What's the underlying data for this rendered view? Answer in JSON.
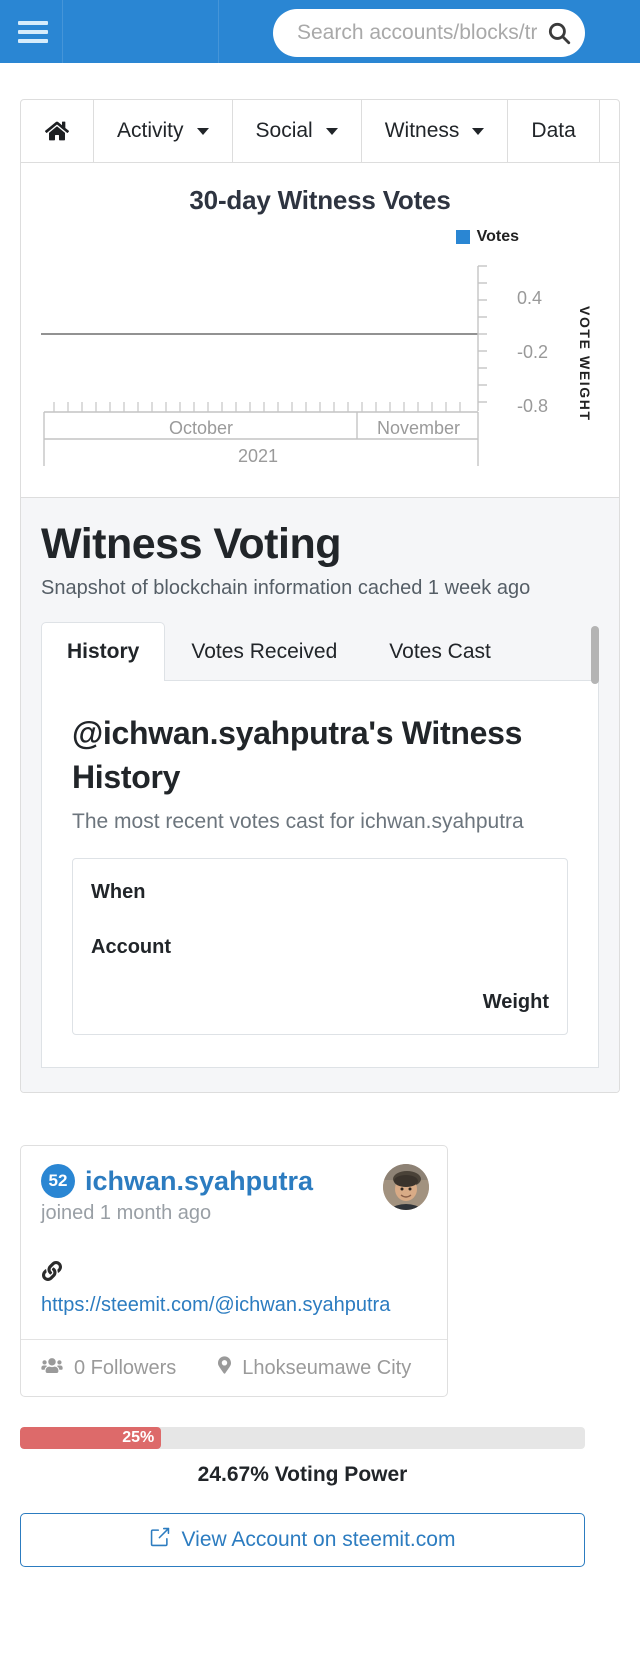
{
  "navbar": {
    "menu_icon": "hamburger-icon",
    "search": {
      "placeholder": "Search accounts/blocks/transactions",
      "value": "",
      "icon": "search-icon"
    }
  },
  "nav_tabs": [
    {
      "label": "",
      "icon": "home-icon",
      "has_caret": false
    },
    {
      "label": "Activity",
      "has_caret": true
    },
    {
      "label": "Social",
      "has_caret": true
    },
    {
      "label": "Witness",
      "has_caret": true
    },
    {
      "label": "Data",
      "has_caret": false
    }
  ],
  "chart_data": {
    "type": "line",
    "title": "30-day Witness Votes",
    "xlabel": "",
    "ylabel": "VOTE WEIGHT",
    "legend": [
      {
        "name": "Votes",
        "color": "#2a86d3"
      }
    ],
    "legend_position": "top-right",
    "grid": false,
    "ylim": [
      -1.1,
      0.7
    ],
    "yticks": [
      0.4,
      -0.2,
      -0.8
    ],
    "ytick_labels": [
      "0.4",
      "-0.2",
      "-0.8"
    ],
    "x_group_year": "2021",
    "x_groups": [
      "October",
      "November"
    ],
    "series": [
      {
        "name": "Votes",
        "x": [],
        "values": []
      }
    ],
    "baseline_value": 0,
    "note": "No vote data points plotted; flat zero baseline only"
  },
  "witness_voting": {
    "heading": "Witness Voting",
    "subheading": "Snapshot of blockchain information cached 1 week ago",
    "tabs": [
      {
        "label": "History",
        "active": true
      },
      {
        "label": "Votes Received",
        "active": false
      },
      {
        "label": "Votes Cast",
        "active": false
      }
    ],
    "pane": {
      "title": "@ichwan.syahputra's Witness History",
      "description": "The most recent votes cast for ichwan.syahputra",
      "table_headers": [
        "When",
        "Account",
        "Weight"
      ],
      "rows": []
    }
  },
  "profile_card": {
    "reputation": "52",
    "username": "ichwan.syahputra",
    "joined": "joined 1 month ago",
    "link_icon": "link-icon",
    "website": "https://steemit.com/@ichwan.syahputra",
    "followers_icon": "users-icon",
    "followers": "0 Followers",
    "location_icon": "map-pin-icon",
    "location": "Lhokseumawe City",
    "avatar": "avatar-photo"
  },
  "voting_power": {
    "bar_label": "25%",
    "bar_percent": 25,
    "caption": "24.67% Voting Power",
    "bar_color": "#dd6a6a",
    "track_color": "#e6e6e6"
  },
  "view_account_button": {
    "label": "View Account on steemit.com",
    "icon": "external-link-icon"
  },
  "colors": {
    "brand_blue": "#2a86d3",
    "link_blue": "#2c7cc0",
    "panel_bg": "#f5f6f8",
    "danger": "#dd6a6a"
  }
}
